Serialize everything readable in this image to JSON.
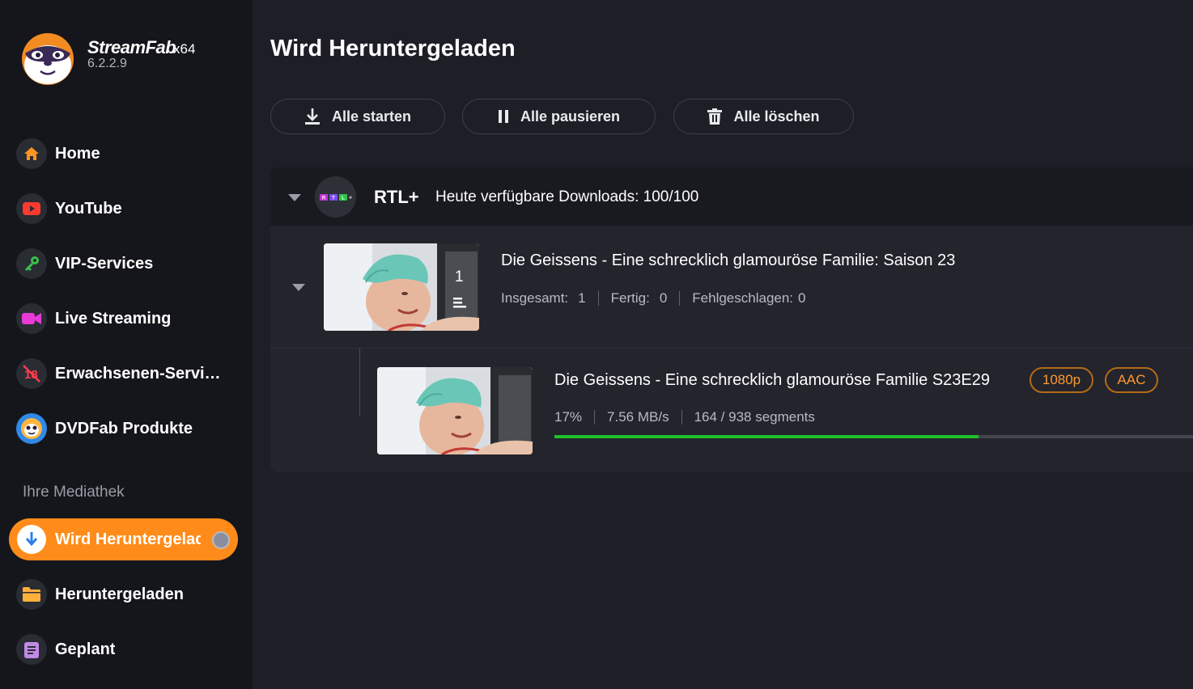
{
  "app": {
    "name": "StreamFab",
    "arch": "x64",
    "version": "6.2.2.9"
  },
  "sidebar": {
    "items": [
      {
        "label": "Home",
        "icon": "home-icon",
        "color": "#ff9520"
      },
      {
        "label": "YouTube",
        "icon": "youtube-icon",
        "color": "#ff3b30"
      },
      {
        "label": "VIP-Services",
        "icon": "key-icon",
        "color": "#39c24a"
      },
      {
        "label": "Live Streaming",
        "icon": "camera-icon",
        "color": "#e83ad6"
      },
      {
        "label": "Erwachsenen-Services",
        "icon": "adult-18-icon",
        "color": "#ff3b4e"
      },
      {
        "label": "DVDFab Produkte",
        "icon": "dvdfab-icon",
        "color": "#2f8ae8"
      }
    ],
    "library_title": "Ihre Mediathek",
    "library": [
      {
        "label": "Wird Heruntergeladen",
        "icon": "download-icon",
        "active": true
      },
      {
        "label": "Heruntergeladen",
        "icon": "folder-icon",
        "color": "#ffb13b"
      },
      {
        "label": "Geplant",
        "icon": "schedule-icon",
        "color": "#c08ae6"
      }
    ]
  },
  "main": {
    "title": "Wird Heruntergeladen",
    "toolbar": {
      "start_all": "Alle starten",
      "pause_all": "Alle pausieren",
      "delete_all": "Alle löschen"
    },
    "group": {
      "service": "RTL+",
      "quota": "Heute verfügbare Downloads: 100/100",
      "season": {
        "title": "Die Geissens - Eine schrecklich glamouröse Familie: Saison 23",
        "count_badge": "1",
        "total_label": "Insgesamt:",
        "total_value": "1",
        "done_label": "Fertig:",
        "done_value": "0",
        "failed_label": "Fehlgeschlagen:",
        "failed_value": "0"
      },
      "episode": {
        "title": "Die Geissens - Eine schrecklich glamouröse Familie S23E29",
        "resolution": "1080p",
        "audio": "AAC",
        "percent": "17%",
        "speed": "7.56 MB/s",
        "segments": "164 / 938 segments",
        "progress": 0.17
      }
    }
  },
  "colors": {
    "accent": "#ff8c1a",
    "progress": "#20c02a",
    "pill_text": "#ff9a2e"
  }
}
